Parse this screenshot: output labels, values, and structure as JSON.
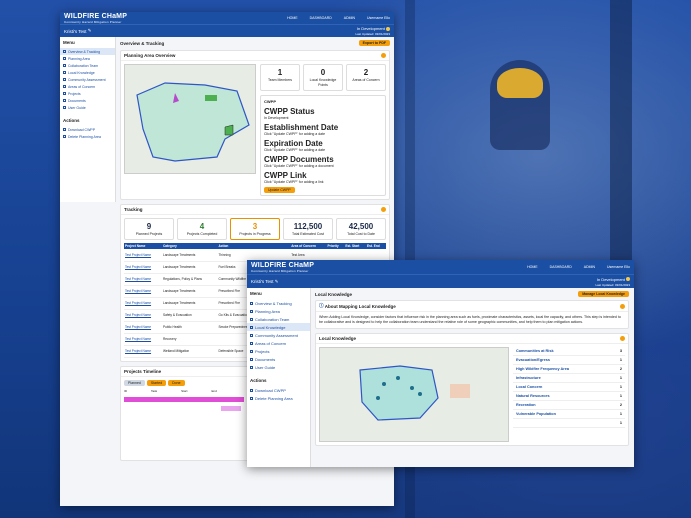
{
  "app": {
    "title": "WILDFIRE CHaMP",
    "tagline": "Community Hazard Mitigation Planner",
    "nav": [
      "HOME",
      "DASHBOARD",
      "ADMIN"
    ],
    "user": "Username Ello"
  },
  "project": {
    "name": "Kristi's Test",
    "status": "In Development",
    "updated": "Last Updated: 03/01/2023"
  },
  "sidebar": {
    "menu_title": "Menu",
    "items": [
      "Overview & Tracking",
      "Planning Area",
      "Collaboration Team",
      "Local Knowledge",
      "Community Assessment",
      "Areas of Concern",
      "Projects",
      "Documents",
      "User Guide"
    ],
    "actions_title": "Actions",
    "actions": [
      "Download CWPP",
      "Delete Planning Area"
    ]
  },
  "overview": {
    "title": "Overview & Tracking",
    "button": "Export to PDF",
    "planning_area_title": "Planning Area Overview",
    "stats": [
      {
        "value": "1",
        "label": "Team Members"
      },
      {
        "value": "0",
        "label": "Local Knowledge Points"
      },
      {
        "value": "2",
        "label": "Areas of Concern"
      }
    ],
    "cwpp_title": "CWPP",
    "cwpp": [
      {
        "k": "CWPP Status",
        "v": "In Development"
      },
      {
        "k": "Establishment Date",
        "v": "Click \"Update CWPP\" for adding a date"
      },
      {
        "k": "Expiration Date",
        "v": "Click \"Update CWPP\" for adding a date"
      },
      {
        "k": "CWPP Documents",
        "v": "Click \"Update CWPP\" for adding a document"
      },
      {
        "k": "CWPP Link",
        "v": "Click \"Update CWPP\" for adding a link"
      }
    ],
    "update_button": "Update CWPP"
  },
  "tracking": {
    "title": "Tracking",
    "stats": [
      {
        "value": "9",
        "label": "Planned Projects",
        "color": "#1a2b4a"
      },
      {
        "value": "4",
        "label": "Projects Completed",
        "color": "#2e7d32"
      },
      {
        "value": "3",
        "label": "Projects in Progress",
        "color": "#e69100"
      },
      {
        "value": "112,500",
        "label": "Total Estimated Cost",
        "color": "#1a2b4a"
      },
      {
        "value": "42,500",
        "label": "Total Cost to Date",
        "color": "#1a2b4a"
      }
    ],
    "columns": [
      "Project Name",
      "Category",
      "Action",
      "Area of Concern",
      "Priority",
      "Est. Start",
      "Est. End"
    ],
    "rows": [
      [
        "Test Project Name",
        "Landscape Treatments",
        "Thinning",
        "Test Area",
        "",
        "",
        ""
      ],
      [
        "Test Project Name",
        "Landscape Treatments",
        "Fuel Breaks",
        "Test Area",
        "",
        "",
        ""
      ],
      [
        "Test Project Name",
        "Regulations, Policy & Plans",
        "Community Wildfire Protection Plans",
        "Test Area",
        "",
        "",
        ""
      ],
      [
        "Test Project Name",
        "Landscape Treatments",
        "Prescribed Fire",
        "Test Area",
        "",
        "",
        ""
      ],
      [
        "Test Project Name",
        "Landscape Treatments",
        "Prescribed Fire",
        "Test Area",
        "",
        "",
        ""
      ],
      [
        "Test Project Name",
        "Safety & Evacuation",
        "Go Kits & Evacuation Plans",
        "Test Area",
        "",
        "",
        ""
      ],
      [
        "Test Project Name",
        "Public Health",
        "Smoke Preparedness",
        "Test Area",
        "",
        "",
        ""
      ],
      [
        "Test Project Name",
        "Recovery",
        "",
        "Test Area",
        "",
        "",
        ""
      ],
      [
        "Test Project Name",
        "Wetland Mitigation",
        "Defensible Space",
        "Test Area",
        "",
        "",
        ""
      ]
    ],
    "timeline_title": "Projects Timeline",
    "timeline_chips": [
      "Planned",
      "Started",
      "Done"
    ],
    "timeline_header": [
      "ID",
      "Task",
      "Start",
      "End"
    ]
  },
  "local": {
    "title": "Local Knowledge",
    "button": "Manage Local Knowledge",
    "about_title": "About Mapping Local Knowledge",
    "about_text": "When Adding Local Knowledge, consider factors that influence risk in the planning area such as fuels, proximate characteristics, assets, local fire capacity, and others. This step is intended to be collaborative and is designed to help the collaboration team understand the relative role of some geographic communities, and help them to plan mitigation actions.",
    "map_title": "Local Knowledge",
    "categories": [
      {
        "name": "Communities at Risk",
        "count": "3"
      },
      {
        "name": "Evacuation/Egress",
        "count": "1"
      },
      {
        "name": "High Wildfire Frequency Area",
        "count": "2"
      },
      {
        "name": "Infrastructure",
        "count": "1"
      },
      {
        "name": "Local Concern",
        "count": "1"
      },
      {
        "name": "Natural Resources",
        "count": "1"
      },
      {
        "name": "Recreation",
        "count": "2"
      },
      {
        "name": "Vulnerable Population",
        "count": "1"
      },
      {
        "name": "",
        "count": "1"
      }
    ]
  }
}
